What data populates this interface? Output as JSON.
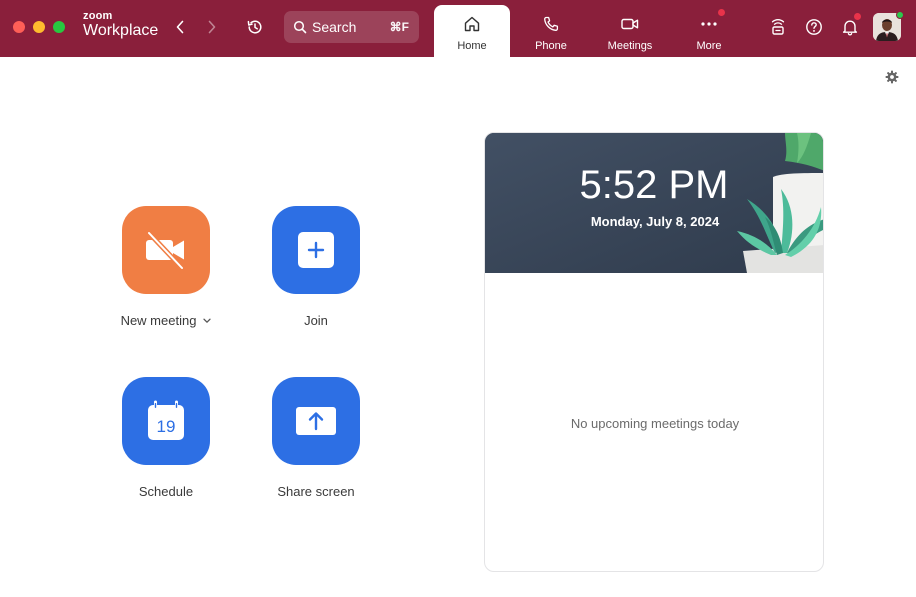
{
  "app": {
    "brand_line1": "zoom",
    "brand_line2": "Workplace"
  },
  "search": {
    "label": "Search",
    "shortcut": "⌘F"
  },
  "tabs": [
    {
      "label": "Home",
      "icon": "home-icon",
      "active": true
    },
    {
      "label": "Phone",
      "icon": "phone-icon",
      "active": false
    },
    {
      "label": "Meetings",
      "icon": "video-camera-icon",
      "active": false
    },
    {
      "label": "More",
      "icon": "more-dots-icon",
      "active": false,
      "badge": true
    }
  ],
  "actions": {
    "new_meeting": "New meeting",
    "join": "Join",
    "schedule": "Schedule",
    "schedule_day": "19",
    "share_screen": "Share screen"
  },
  "panel": {
    "time": "5:52 PM",
    "date": "Monday, July 8, 2024",
    "empty_message": "No upcoming meetings today"
  },
  "colors": {
    "titlebar": "#8a1f3b",
    "new_meeting_tile": "#f07e44",
    "action_tile": "#2d6fe4",
    "banner": "#3a475a",
    "badge": "#e8334a",
    "presence": "#2cc84d"
  }
}
